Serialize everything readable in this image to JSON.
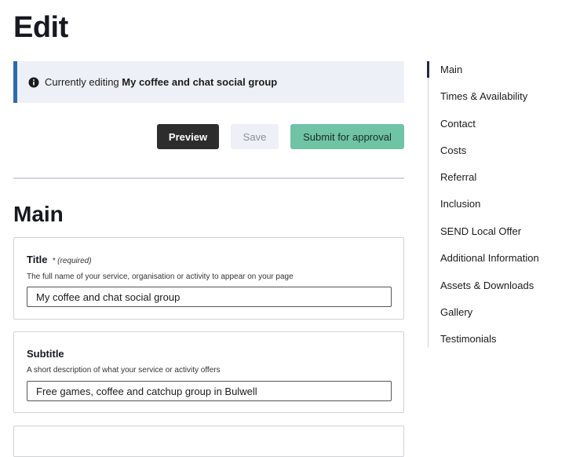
{
  "page": {
    "title": "Edit"
  },
  "notice": {
    "prefix": "Currently editing ",
    "name": "My coffee and chat social group"
  },
  "actions": {
    "preview": "Preview",
    "save": "Save",
    "submit": "Submit for approval"
  },
  "section": {
    "title": "Main"
  },
  "fields": {
    "title": {
      "label": "Title",
      "required": "* (required)",
      "hint": "The full name of your service, organisation or activity to appear on your page",
      "value": "My coffee and chat social group"
    },
    "subtitle": {
      "label": "Subtitle",
      "hint": "A short description of what your service or activity offers",
      "value": "Free games, coffee and catchup group in Bulwell"
    }
  },
  "sidenav": {
    "active": "Main",
    "items": [
      "Main",
      "Times & Availability",
      "Contact",
      "Costs",
      "Referral",
      "Inclusion",
      "SEND Local Offer",
      "Additional Information",
      "Assets & Downloads",
      "Gallery",
      "Testimonials"
    ]
  },
  "colors": {
    "accent": "#2b6cb0",
    "submit": "#6fc4a6",
    "preview": "#2d2d2d"
  }
}
